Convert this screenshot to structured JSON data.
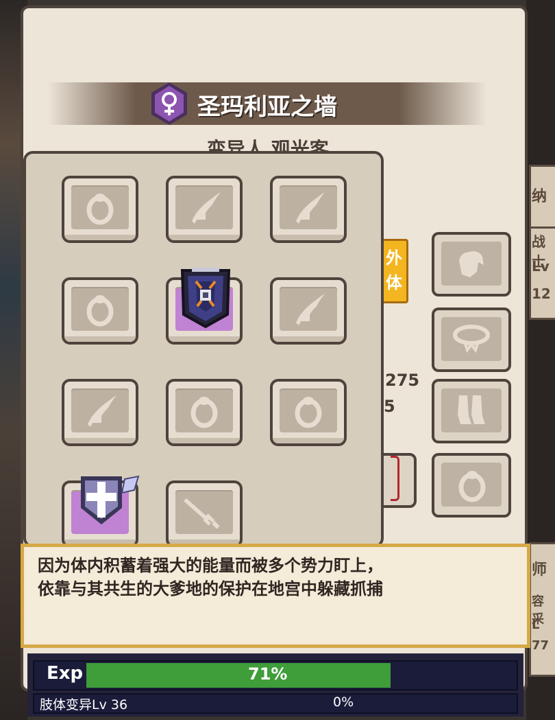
{
  "background_right_labels": [
    "纳",
    "战士",
    "Lv",
    "12",
    "师",
    "容采",
    "L",
    "77"
  ],
  "hero": {
    "name": "圣玛利亚之墙",
    "gender_icon": "female-symbol-icon",
    "subtitle": "变异人 观光客",
    "tag": "外体"
  },
  "stats_partial": [
    "275",
    "5"
  ],
  "equipment_slots": [
    {
      "row": 1,
      "col": 1,
      "type": "ring",
      "filled": false
    },
    {
      "row": 1,
      "col": 2,
      "type": "weapon-feather",
      "filled": false
    },
    {
      "row": 1,
      "col": 3,
      "type": "weapon-feather",
      "filled": false
    },
    {
      "row": 2,
      "col": 1,
      "type": "ring",
      "filled": false
    },
    {
      "row": 2,
      "col": 2,
      "type": "dark-shield",
      "filled": true
    },
    {
      "row": 2,
      "col": 3,
      "type": "weapon-feather",
      "filled": false
    },
    {
      "row": 3,
      "col": 1,
      "type": "weapon-feather",
      "filled": false
    },
    {
      "row": 3,
      "col": 2,
      "type": "ring",
      "filled": false
    },
    {
      "row": 3,
      "col": 3,
      "type": "ring",
      "filled": false
    },
    {
      "row": 4,
      "col": 1,
      "type": "cross-shield",
      "filled": true
    },
    {
      "row": 4,
      "col": 2,
      "type": "dagger",
      "filled": false
    }
  ],
  "side_slots": [
    "glove-icon",
    "necklace-icon",
    "boots-icon",
    "ring-icon"
  ],
  "description": {
    "line1": "因为体内积蓄着强大的能量而被多个势力盯上，",
    "line2": "依靠与其共生的大爹地的保护在地宫中躲藏抓捕"
  },
  "exp": {
    "label": "Exp",
    "percent_text": "71%",
    "progress": 0.71
  },
  "mutation": {
    "label": "肢体变异Lv 36",
    "percent_text": "0%",
    "progress": 0
  },
  "colors": {
    "exp_fill": "#3f9d3a",
    "gender_badge": "#8c55b0",
    "tag_badge": "#f3b520",
    "desc_border": "#d6a947"
  }
}
